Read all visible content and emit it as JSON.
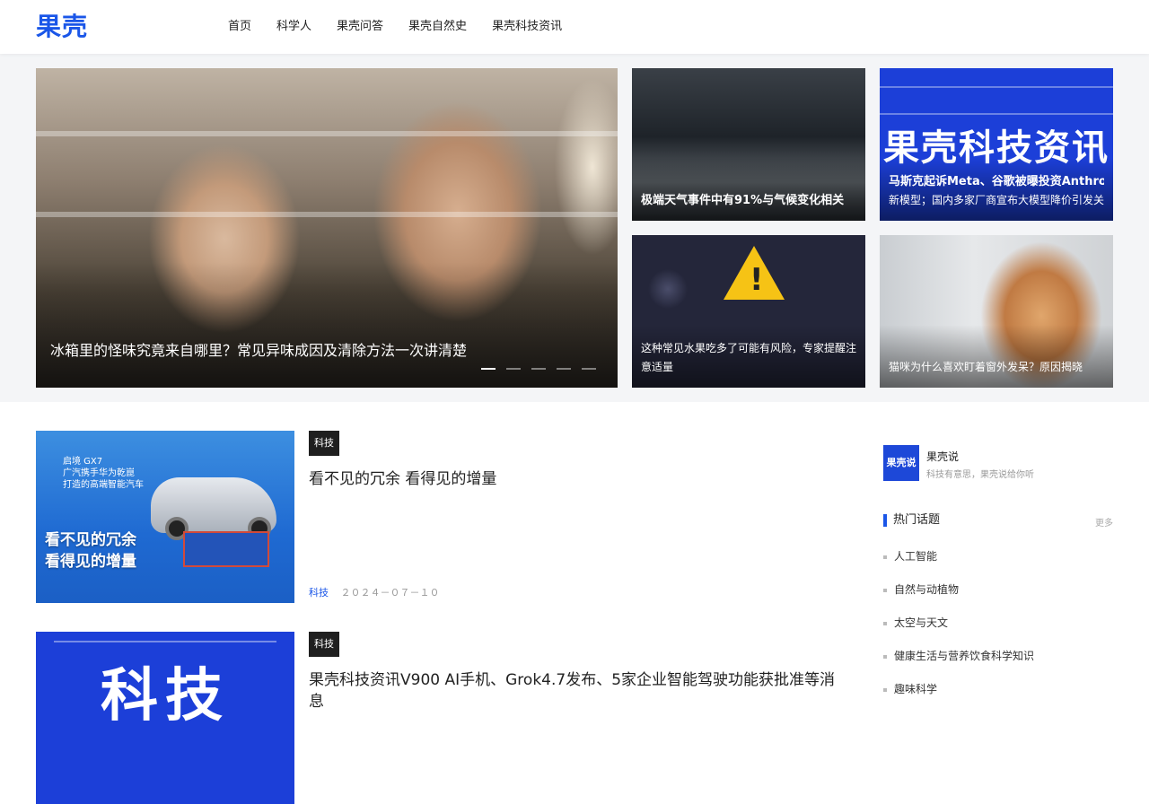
{
  "header": {
    "logo": "果壳",
    "nav": [
      "首页",
      "科学人",
      "果壳问答",
      "果壳自然史",
      "果壳科技资讯"
    ]
  },
  "hero": {
    "main_caption": "冰箱里的怪味究竟来自哪里？常见异味成因及清除方法一次讲清楚",
    "dots": 5,
    "active_dot": 0,
    "tiles": [
      {
        "line1": "极端天气事件中有91%与气候变化相关",
        "line2": ""
      },
      {
        "image_text": "果壳科技资讯",
        "line1": "马斯克起诉Meta、谷歌被曝投资Anthropic，OpenAI发布",
        "line2": "新模型；国内多家厂商宣布大模型降价引发关注"
      },
      {
        "line1": "这种常见水果吃多了可能有风险，专家提醒注意适量",
        "line2": ""
      },
      {
        "line1": "猫咪为什么喜欢盯着窗外发呆？原因揭晓",
        "line2": ""
      }
    ]
  },
  "articles": [
    {
      "tag": "科技",
      "title": "看不见的冗余 看得见的增量",
      "category": "科技",
      "date": "２０２４－０７－１０",
      "thumb": {
        "brand": "启境 GX7",
        "brand2": "广汽携手华为乾崑",
        "brand3": "打造的高端智能汽车",
        "line1": "看不见的冗余",
        "line2": "看得见的增量"
      }
    },
    {
      "tag": "科技",
      "title": "果壳科技资讯V900 AI手机、Grok4.7发布、5家企业智能驾驶功能获批准等消息",
      "category": "",
      "date": "",
      "thumb": {
        "text": "科技"
      }
    }
  ],
  "sidebar": {
    "profile": {
      "name": "果壳说",
      "avatar_text": "果壳说",
      "desc": "科技有意思，果壳说给你听"
    },
    "section_title": "热门话题",
    "section_more": "更多",
    "topics": [
      "人工智能",
      "自然与动植物",
      "太空与天文",
      "健康生活与营养饮食科学知识",
      "趣味科学"
    ]
  },
  "colors": {
    "accent": "#1a56e8",
    "tag_bg": "#1f1f1f",
    "hero_bg": "#f4f5f7"
  }
}
